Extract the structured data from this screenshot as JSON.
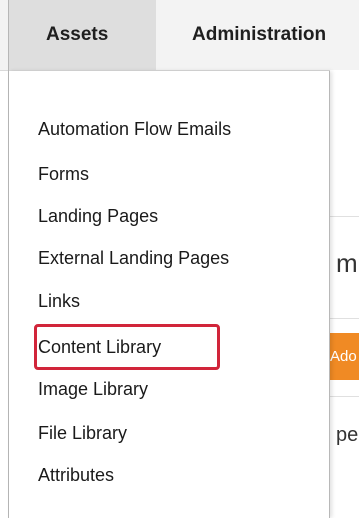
{
  "tabs": [
    {
      "label": "Assets",
      "active": true
    },
    {
      "label": "Administration",
      "active": false
    }
  ],
  "assets_menu": {
    "items": [
      {
        "label": "Automation Flow Emails"
      },
      {
        "label": "Forms"
      },
      {
        "label": "Landing Pages"
      },
      {
        "label": "External Landing Pages"
      },
      {
        "label": "Links"
      },
      {
        "label": "Content Library",
        "highlighted": true
      },
      {
        "label": "Image Library"
      },
      {
        "label": "File Library"
      },
      {
        "label": "Attributes"
      }
    ]
  },
  "background": {
    "heading_fragment": "mı",
    "button_fragment": "Ado",
    "text_fragment": "pe"
  },
  "colors": {
    "tab_bar_bg": "#f3f3f3",
    "active_tab_bg": "#dedede",
    "highlight_border": "#d1253a",
    "orange_button": "#f08a24"
  }
}
